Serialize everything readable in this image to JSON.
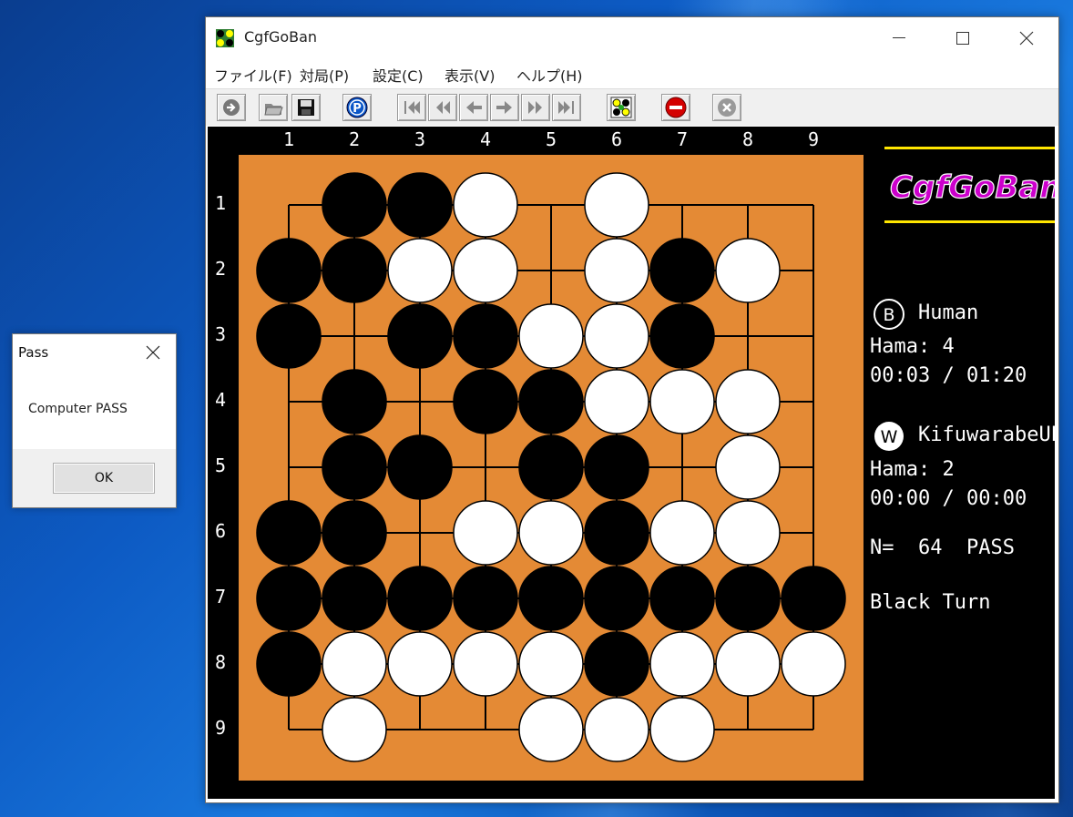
{
  "dialog": {
    "title": "Pass",
    "message": "Computer PASS",
    "ok_label": "OK"
  },
  "window": {
    "title": "CgfGoBan"
  },
  "menu": [
    {
      "label": "ファイル(F)"
    },
    {
      "label": "対局(P)"
    },
    {
      "label": "設定(C)"
    },
    {
      "label": "表示(V)"
    },
    {
      "label": "ヘルプ(H)"
    }
  ],
  "toolbar": [
    {
      "icon": "undo-arrow-icon"
    },
    {
      "icon": "open-folder-icon"
    },
    {
      "icon": "save-disk-icon"
    },
    {
      "icon": "pass-p-icon"
    },
    {
      "icon": "first-move-icon"
    },
    {
      "icon": "back-fast-icon"
    },
    {
      "icon": "back-one-icon"
    },
    {
      "icon": "forward-one-icon"
    },
    {
      "icon": "forward-fast-icon"
    },
    {
      "icon": "last-move-icon"
    },
    {
      "icon": "board-setup-icon"
    },
    {
      "icon": "stop-icon"
    },
    {
      "icon": "close-game-icon"
    }
  ],
  "board": {
    "size": 9,
    "columns": [
      "1",
      "2",
      "3",
      "4",
      "5",
      "6",
      "7",
      "8",
      "9"
    ],
    "rows": [
      "1",
      "2",
      "3",
      "4",
      "5",
      "6",
      "7",
      "8",
      "9"
    ],
    "stones": [
      ".BBW.W...",
      "BBWW.WBW.",
      "B.BBWWB..",
      ".B.BBWWW.",
      ".BB.BB.W.",
      "BB.WWBWW.",
      "BBBBBBBBB",
      "BWWWWBWWW",
      ".W..WWW.."
    ]
  },
  "logo_text": "CgfGoBan",
  "players": {
    "black": {
      "badge": "B",
      "name": "Human",
      "hama": "Hama: 4",
      "time": "00:03 / 01:20"
    },
    "white": {
      "badge": "W",
      "name": "KifuwarabeUEC",
      "hama": "Hama: 2",
      "time": "00:00 / 00:00"
    }
  },
  "move_status": "N=  64  PASS",
  "turn_status": "Black Turn",
  "colors": {
    "board": "#e48a35",
    "logo_text": "#cc00cc",
    "logo_bar": "#ffe600"
  }
}
